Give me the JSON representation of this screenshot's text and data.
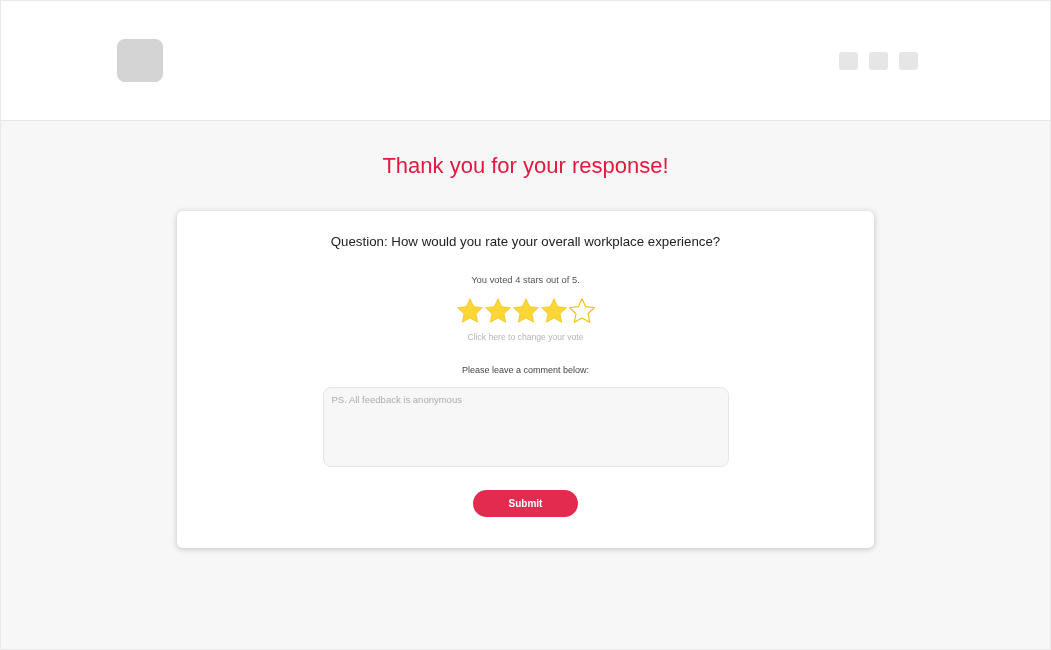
{
  "title": "Thank you for your response!",
  "card": {
    "question": "Question: How would you rate your overall workplace experience?",
    "vote_summary": "You voted 4 stars out of 5.",
    "rating": {
      "stars": 4
    },
    "change_vote_link": "Click here to change your vote",
    "comment_label": "Please leave a comment below:",
    "comment_field": {
      "placeholder": "PS. All feedback is anonymous"
    },
    "submit_button": "Submit"
  }
}
